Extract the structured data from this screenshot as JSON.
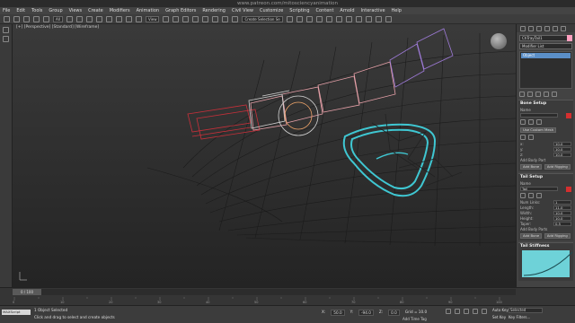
{
  "watermark": "www.patreon.com/mitosciencyanimation",
  "menu": [
    "File",
    "Edit",
    "Tools",
    "Group",
    "Views",
    "Create",
    "Modifiers",
    "Animation",
    "Graph Editors",
    "Rendering",
    "Civil View",
    "Customize",
    "Scripting",
    "Content",
    "Arnold",
    "Interactive",
    "Help"
  ],
  "toolbar": {
    "filter_select": "All",
    "view_select": "View",
    "selection_set": "Create Selection Se"
  },
  "viewport": {
    "label": "[+] [Perspective] [Standard] [Wireframe]"
  },
  "command_panel": {
    "object_name": "ChTrayTail1",
    "modifier_list": "Modifier List",
    "stack_item": "Object",
    "bone_setup": {
      "title": "Bone Setup",
      "name_label": "Name",
      "name_value": "",
      "use_custom_mesh": "Use Custom Mesh",
      "x_label": "x:",
      "x_value": "10.0",
      "y_label": "y:",
      "y_value": "10.0",
      "z_label": "z:",
      "z_value": "10.0",
      "add_body_part": "Add Body Part",
      "add_bone": "Add Bone",
      "add_rigging": "Add Rigging"
    },
    "tail_setup": {
      "title": "Tail Setup",
      "name_label": "Name",
      "name_value": "Tail",
      "num_links_label": "Num Links:",
      "num_links_value": "1",
      "length_label": "Length:",
      "length_value": "11.0",
      "width_label": "Width:",
      "width_value": "10.0",
      "height_label": "Height:",
      "height_value": "10.0",
      "taper_label": "Taper:",
      "taper_value": "0.5",
      "add_body_parts": "Add Body Parts",
      "add_bone": "Add Bone",
      "add_rigging": "Add Rigging"
    },
    "tail_stiffness": {
      "title": "Tail Stiffness"
    }
  },
  "timeline": {
    "frame_display": "0 / 100",
    "ticks": [
      "0",
      "10",
      "20",
      "30",
      "40",
      "50",
      "60",
      "70",
      "80",
      "90",
      "100"
    ]
  },
  "status": {
    "script_box": "MAXScript",
    "selected": "1 Object Selected",
    "prompt": "Click and drag to select and create objects",
    "x_label": "X:",
    "x_value": "50.0",
    "y_label": "Y:",
    "y_value": "-94.0",
    "z_label": "Z:",
    "z_value": "0.0",
    "grid_label": "Grid = 10.0",
    "add_time_tag": "Add Time Tag",
    "auto_key": "Auto Key",
    "set_key": "Set Key",
    "selected_dropdown": "Selected",
    "key_filters": "Key Filters..."
  }
}
